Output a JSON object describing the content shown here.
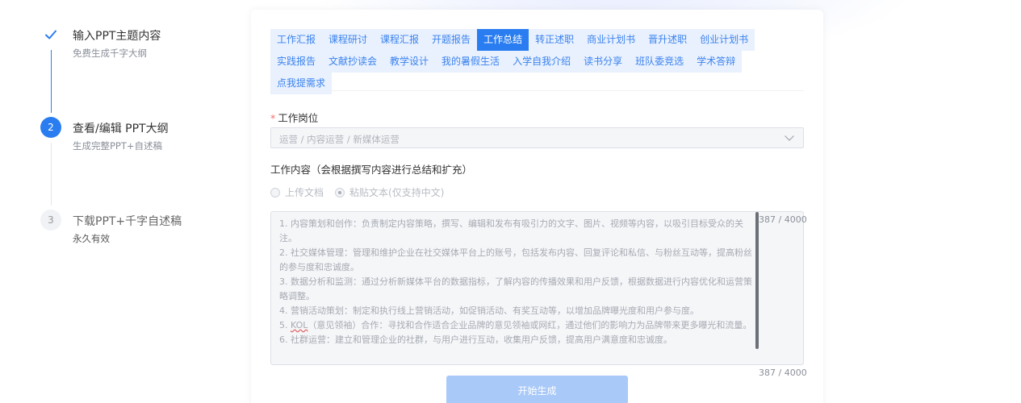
{
  "stepper": {
    "steps": [
      {
        "marker": "",
        "title": "输入PPT主题内容",
        "sub": "免费生成千字大纲"
      },
      {
        "marker": "2",
        "title": "查看/编辑 PPT大纲",
        "sub": "生成完整PPT+自述稿"
      },
      {
        "marker": "3",
        "title": "下载PPT+千字自述稿",
        "sub": "永久有效"
      }
    ]
  },
  "tabs": {
    "active_index": 4,
    "items": [
      "工作汇报",
      "课程研讨",
      "课程汇报",
      "开题报告",
      "工作总结",
      "转正述职",
      "商业计划书",
      "晋升述职",
      "创业计划书",
      "实践报告",
      "文献抄读会",
      "教学设计",
      "我的暑假生活",
      "入学自我介绍",
      "读书分享",
      "班队委竞选",
      "学术答辩",
      "点我提需求"
    ]
  },
  "form": {
    "position_required_mark": "*",
    "position_label": "工作岗位",
    "position_placeholder": "运营 / 内容运营 / 新媒体运营",
    "content_label": "工作内容（会根据撰写内容进行总结和扩充）",
    "radio_upload": "上传文档",
    "radio_paste": "粘贴文本(仅支持中文)",
    "text_lines": {
      "l1": "1. 内容策划和创作：负责制定内容策略，撰写、编辑和发布有吸引力的文字、图片、视频等内容，以吸引目标受众的关注。",
      "l2": "2. 社交媒体管理：管理和维护企业在社交媒体平台上的账号，包括发布内容、回复评论和私信、与粉丝互动等，提高粉丝的参与度和忠诚度。",
      "l3": "3. 数据分析和监测：通过分析新媒体平台的数据指标，了解内容的传播效果和用户反馈，根据数据进行内容优化和运营策略调整。",
      "l4": "4. 营销活动策划：制定和执行线上营销活动，如促销活动、有奖互动等，以增加品牌曝光度和用户参与度。",
      "l5_prefix": "5. ",
      "l5_kol": "KOL",
      "l5_rest": "（意见领袖）合作：寻找和合作适合企业品牌的意见领袖或网红，通过他们的影响力为品牌带来更多曝光和流量。",
      "l6": "6. 社群运营：建立和管理企业的社群，与用户进行互动，收集用户反馈，提高用户满意度和忠诚度。"
    },
    "char_count_top": "387 / 4000",
    "char_count_bottom": "387 / 4000",
    "submit_label": "开始生成"
  },
  "colors": {
    "accent": "#2a7df0",
    "tab_bg": "#e9f1fe",
    "button_disabled": "#a9c9f8"
  },
  "icons": {
    "step1": "check-icon",
    "select": "chevron-down-icon"
  }
}
